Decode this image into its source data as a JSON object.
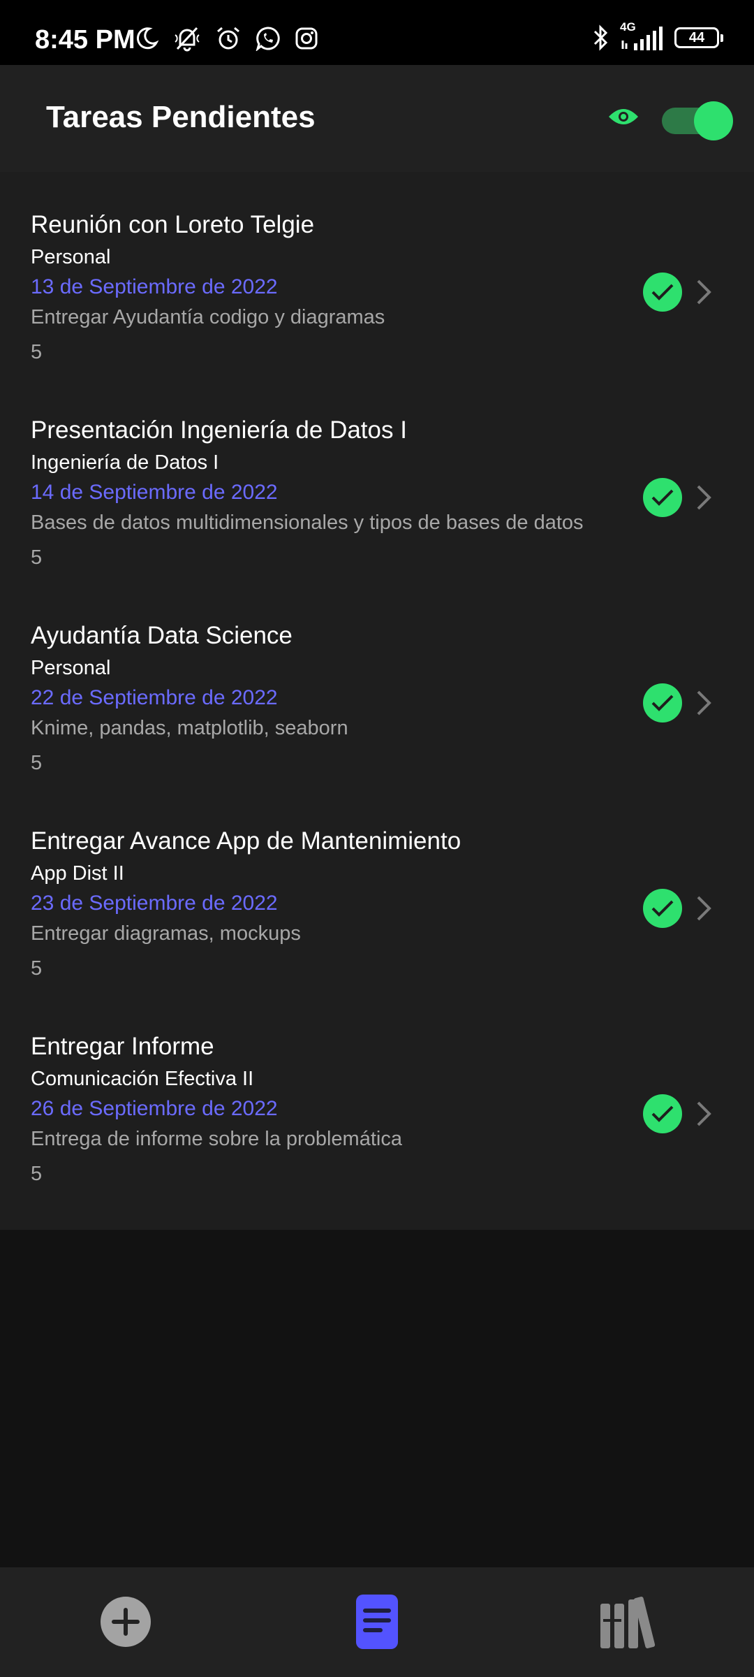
{
  "status_bar": {
    "time": "8:45 PM",
    "network": "4G",
    "battery": "44"
  },
  "header": {
    "title": "Tareas Pendientes",
    "toggle_on": true
  },
  "tasks": [
    {
      "title": "Reunión con Loreto Telgie",
      "category": "Personal",
      "date": "13 de Septiembre de 2022",
      "description": "Entregar Ayudantía codigo y diagramas",
      "count": "5"
    },
    {
      "title": "Presentación Ingeniería de Datos I",
      "category": "Ingeniería de Datos I",
      "date": "14 de Septiembre de 2022",
      "description": "Bases de datos multidimensionales y tipos de bases de datos",
      "count": "5"
    },
    {
      "title": "Ayudantía Data Science",
      "category": "Personal",
      "date": "22 de Septiembre de 2022",
      "description": "Knime, pandas, matplotlib, seaborn",
      "count": "5"
    },
    {
      "title": "Entregar Avance App de Mantenimiento",
      "category": "App Dist II",
      "date": "23 de Septiembre de 2022",
      "description": "Entregar diagramas, mockups",
      "count": "5"
    },
    {
      "title": "Entregar Informe",
      "category": "Comunicación Efectiva II",
      "date": "26 de Septiembre de 2022",
      "description": "Entrega de informe sobre la problemática",
      "count": "5"
    }
  ],
  "bottom_nav": {
    "items": [
      "add-icon",
      "tasks-icon",
      "library-icon"
    ],
    "active": "tasks-icon"
  },
  "colors": {
    "accent_green": "#2ee06e",
    "date_blue": "#6b6bff",
    "nav_active": "#5353ff"
  }
}
